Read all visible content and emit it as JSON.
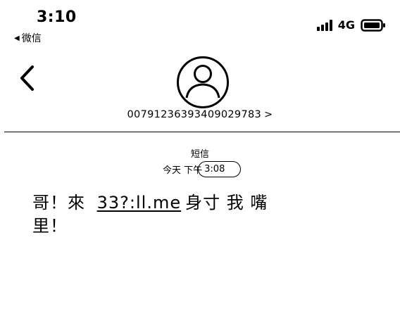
{
  "status_bar": {
    "time": "3:10",
    "back_app": "微信",
    "network": "4G"
  },
  "contact": {
    "number": "00791236393409029783",
    "chevron": ">"
  },
  "message": {
    "channel": "短信",
    "day_label": "今天 下午",
    "time": "3:08",
    "text_before_link": "哥！來 ",
    "link_text": "33?:ll.me",
    "text_after_link": "身寸 我 嘴 里！"
  }
}
